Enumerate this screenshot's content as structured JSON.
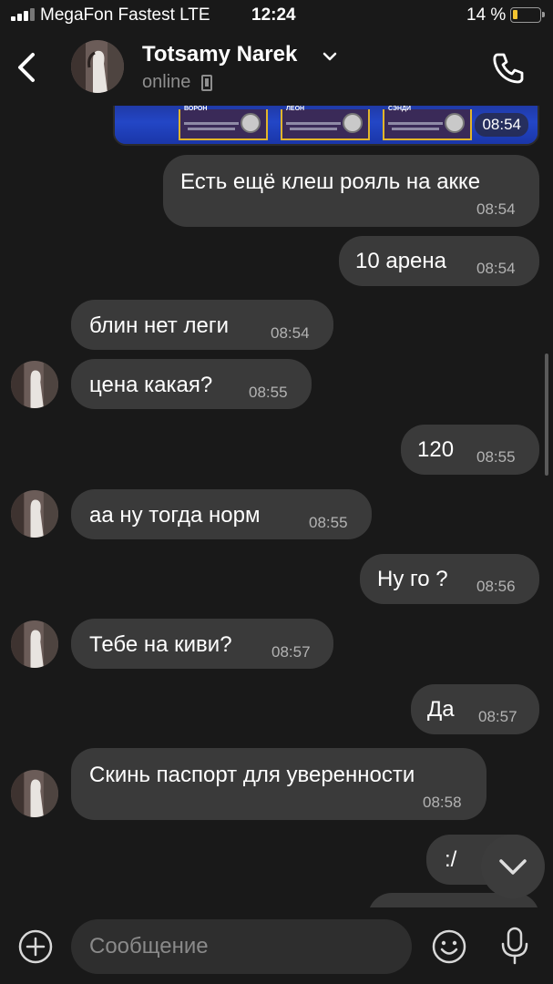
{
  "status_bar": {
    "carrier": "MegaFon Fastest  LTE",
    "time": "12:24",
    "battery": "14 %",
    "battery_level": 0.14
  },
  "header": {
    "contact_name": "Totsamy Narek",
    "contact_status": "online",
    "icons": {
      "back": "back-chevron-icon",
      "expand": "chevron-down-icon",
      "call": "phone-icon",
      "device": "phone-device-icon"
    }
  },
  "image_message": {
    "time": "08:54",
    "card_captions": [
      "ВОРОН",
      "ЛЕОН",
      "СЭНДИ"
    ]
  },
  "messages": [
    {
      "side": "out",
      "text": "Есть ещё клеш рояль на акке",
      "time": "08:54"
    },
    {
      "side": "out",
      "text": "10 арена",
      "time": "08:54"
    },
    {
      "side": "in",
      "text": "блин нет леги",
      "time": "08:54"
    },
    {
      "side": "in",
      "text": "цена какая?",
      "time": "08:55"
    },
    {
      "side": "out",
      "text": "120",
      "time": "08:55"
    },
    {
      "side": "in",
      "text": "аа ну тогда норм",
      "time": "08:55"
    },
    {
      "side": "out",
      "text": "Ну го ?",
      "time": "08:56"
    },
    {
      "side": "in",
      "text": "Тебе на киви?",
      "time": "08:57"
    },
    {
      "side": "out",
      "text": "Да",
      "time": "08:57"
    },
    {
      "side": "in",
      "text": "Скинь паспорт для уверенности",
      "time": "08:58"
    },
    {
      "side": "out",
      "text": ":/",
      "time": ""
    }
  ],
  "input": {
    "placeholder": "Сообщение",
    "icons": {
      "add": "plus-circle-icon",
      "emoji": "emoji-icon",
      "mic": "microphone-icon",
      "scroll_down": "chevron-down-icon"
    }
  }
}
